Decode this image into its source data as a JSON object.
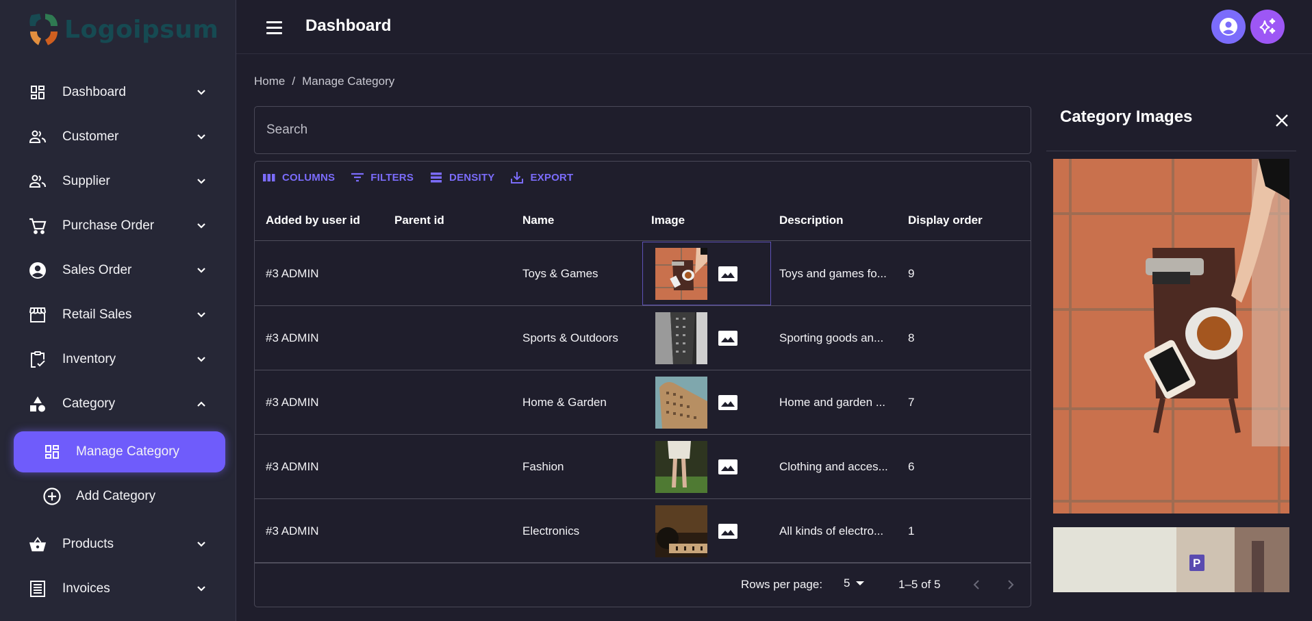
{
  "brand": {
    "logo_text": "Logoipsum",
    "accent": "#6f5cfb"
  },
  "sidebar": {
    "items": [
      {
        "label": "Dashboard",
        "icon": "dashboard-icon",
        "expanded": false
      },
      {
        "label": "Customer",
        "icon": "people-icon",
        "expanded": false
      },
      {
        "label": "Supplier",
        "icon": "people-icon",
        "expanded": false
      },
      {
        "label": "Purchase Order",
        "icon": "cart-icon",
        "expanded": false
      },
      {
        "label": "Sales Order",
        "icon": "account-circle-icon",
        "expanded": false
      },
      {
        "label": "Retail Sales",
        "icon": "storefront-icon",
        "expanded": false
      },
      {
        "label": "Inventory",
        "icon": "clipboard-check-icon",
        "expanded": false
      },
      {
        "label": "Category",
        "icon": "shapes-icon",
        "expanded": true
      },
      {
        "label": "Products",
        "icon": "basket-icon",
        "expanded": false
      },
      {
        "label": "Invoices",
        "icon": "receipt-icon",
        "expanded": false
      }
    ],
    "category_sub": [
      {
        "label": "Manage Category",
        "icon": "dashboard-icon",
        "active": true
      },
      {
        "label": "Add Category",
        "icon": "add-circle-icon",
        "active": false
      }
    ]
  },
  "topbar": {
    "title": "Dashboard"
  },
  "breadcrumb": {
    "home": "Home",
    "separator": "/",
    "current": "Manage Category"
  },
  "search": {
    "placeholder": "Search",
    "value": ""
  },
  "toolbar": {
    "columns": "COLUMNS",
    "filters": "FILTERS",
    "density": "DENSITY",
    "export": "EXPORT"
  },
  "table": {
    "columns": [
      "Added by user id",
      "Parent id",
      "Name",
      "Image",
      "Description",
      "Display order"
    ],
    "rows": [
      {
        "added_by": "#3 ADMIN",
        "parent_id": "",
        "name": "Toys & Games",
        "image": "table-with-tea-cup",
        "description": "Toys and games fo...",
        "display_order": "9"
      },
      {
        "added_by": "#3 ADMIN",
        "parent_id": "",
        "name": "Sports & Outdoors",
        "image": "grayscale-building",
        "description": "Sporting goods an...",
        "display_order": "8"
      },
      {
        "added_by": "#3 ADMIN",
        "parent_id": "",
        "name": "Home & Garden",
        "image": "flatiron-building",
        "description": "Home and garden ...",
        "display_order": "7"
      },
      {
        "added_by": "#3 ADMIN",
        "parent_id": "",
        "name": "Fashion",
        "image": "person-white-dress",
        "description": "Clothing and acces...",
        "display_order": "6"
      },
      {
        "added_by": "#3 ADMIN",
        "parent_id": "",
        "name": "Electronics",
        "image": "night-house-sky",
        "description": "All kinds of electro...",
        "display_order": "1"
      }
    ]
  },
  "pagination": {
    "rows_per_page_label": "Rows per page:",
    "rows_per_page": "5",
    "range": "1–5 of 5"
  },
  "panel": {
    "title": "Category Images",
    "images": [
      "table-with-tea-cup",
      "street-with-parking-sign"
    ]
  }
}
